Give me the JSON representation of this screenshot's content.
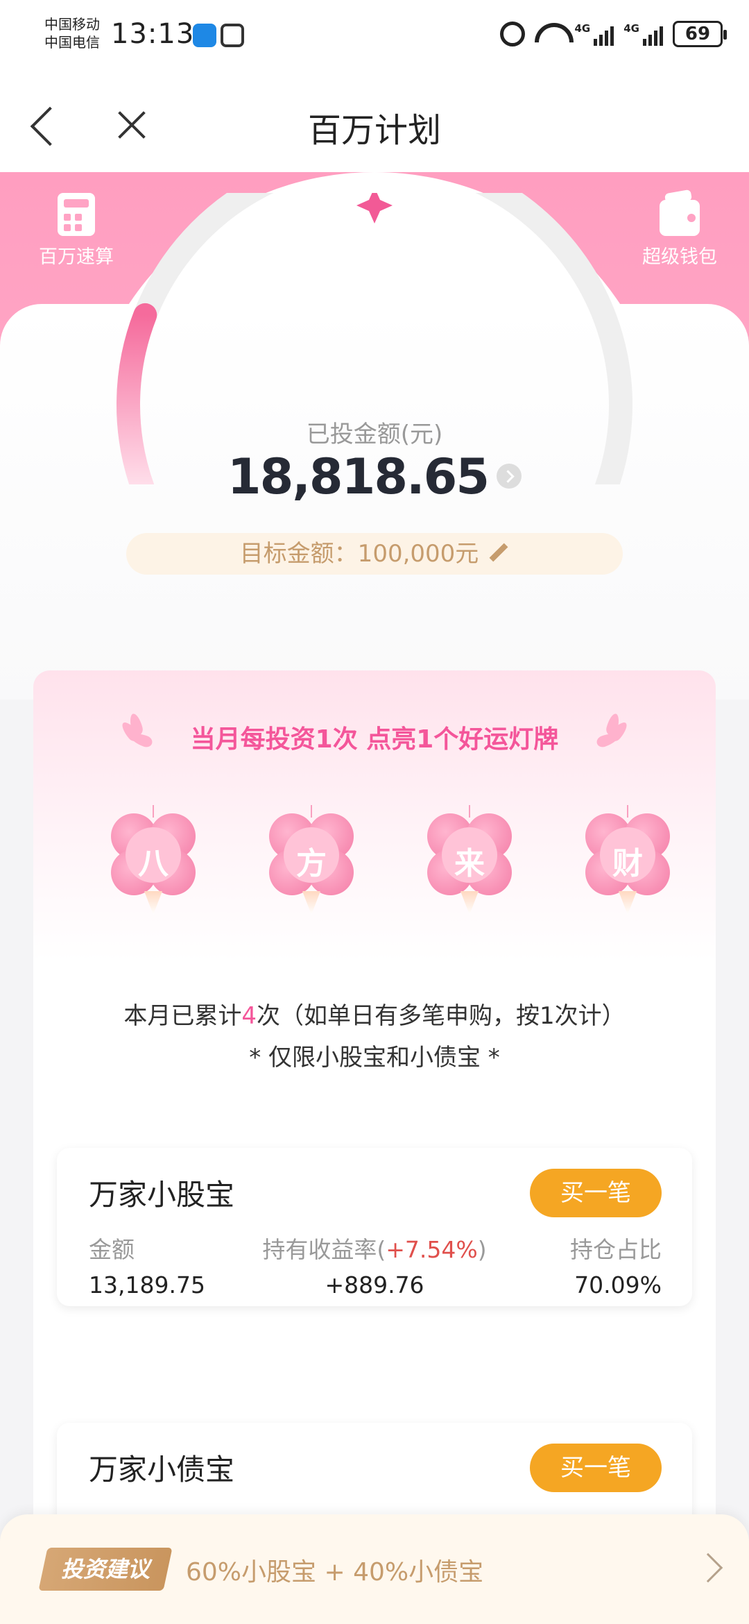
{
  "status_bar": {
    "carrier_1": "中国移动",
    "carrier_2": "中国电信",
    "time": "13:13",
    "signal_1_label": "4G",
    "signal_2_label": "4G",
    "battery": "69"
  },
  "nav": {
    "title": "百万计划"
  },
  "hero": {
    "left_tool_label": "百万速算",
    "right_tool_label": "超级钱包",
    "invested_label": "已投金额(元)",
    "invested_amount": "18,818.65",
    "gauge_progress": 0.188,
    "target_text": "目标金额：100,000元",
    "accent_color": "#ff9ec0"
  },
  "lucky": {
    "title": "当月每投资1次 点亮1个好运灯牌",
    "flowers": [
      "八",
      "方",
      "来",
      "财"
    ],
    "count_prefix": "本月已累计",
    "count_value": "4",
    "count_suffix": "次（如单日有多笔申购，按1次计）",
    "note": "* 仅限小股宝和小债宝 *"
  },
  "products": [
    {
      "name": "万家小股宝",
      "buy_label": "买一笔",
      "amount_label": "金额",
      "amount_value": "13,189.75",
      "return_label": "持有收益率(",
      "return_rate": "+7.54%",
      "return_label_end": ")",
      "return_value": "+889.76",
      "ratio_label": "持仓占比",
      "ratio_value": "70.09%"
    },
    {
      "name": "万家小债宝",
      "buy_label": "买一笔"
    }
  ],
  "advice": {
    "tag": "投资建议",
    "text": "60%小股宝 + 40%小债宝"
  }
}
